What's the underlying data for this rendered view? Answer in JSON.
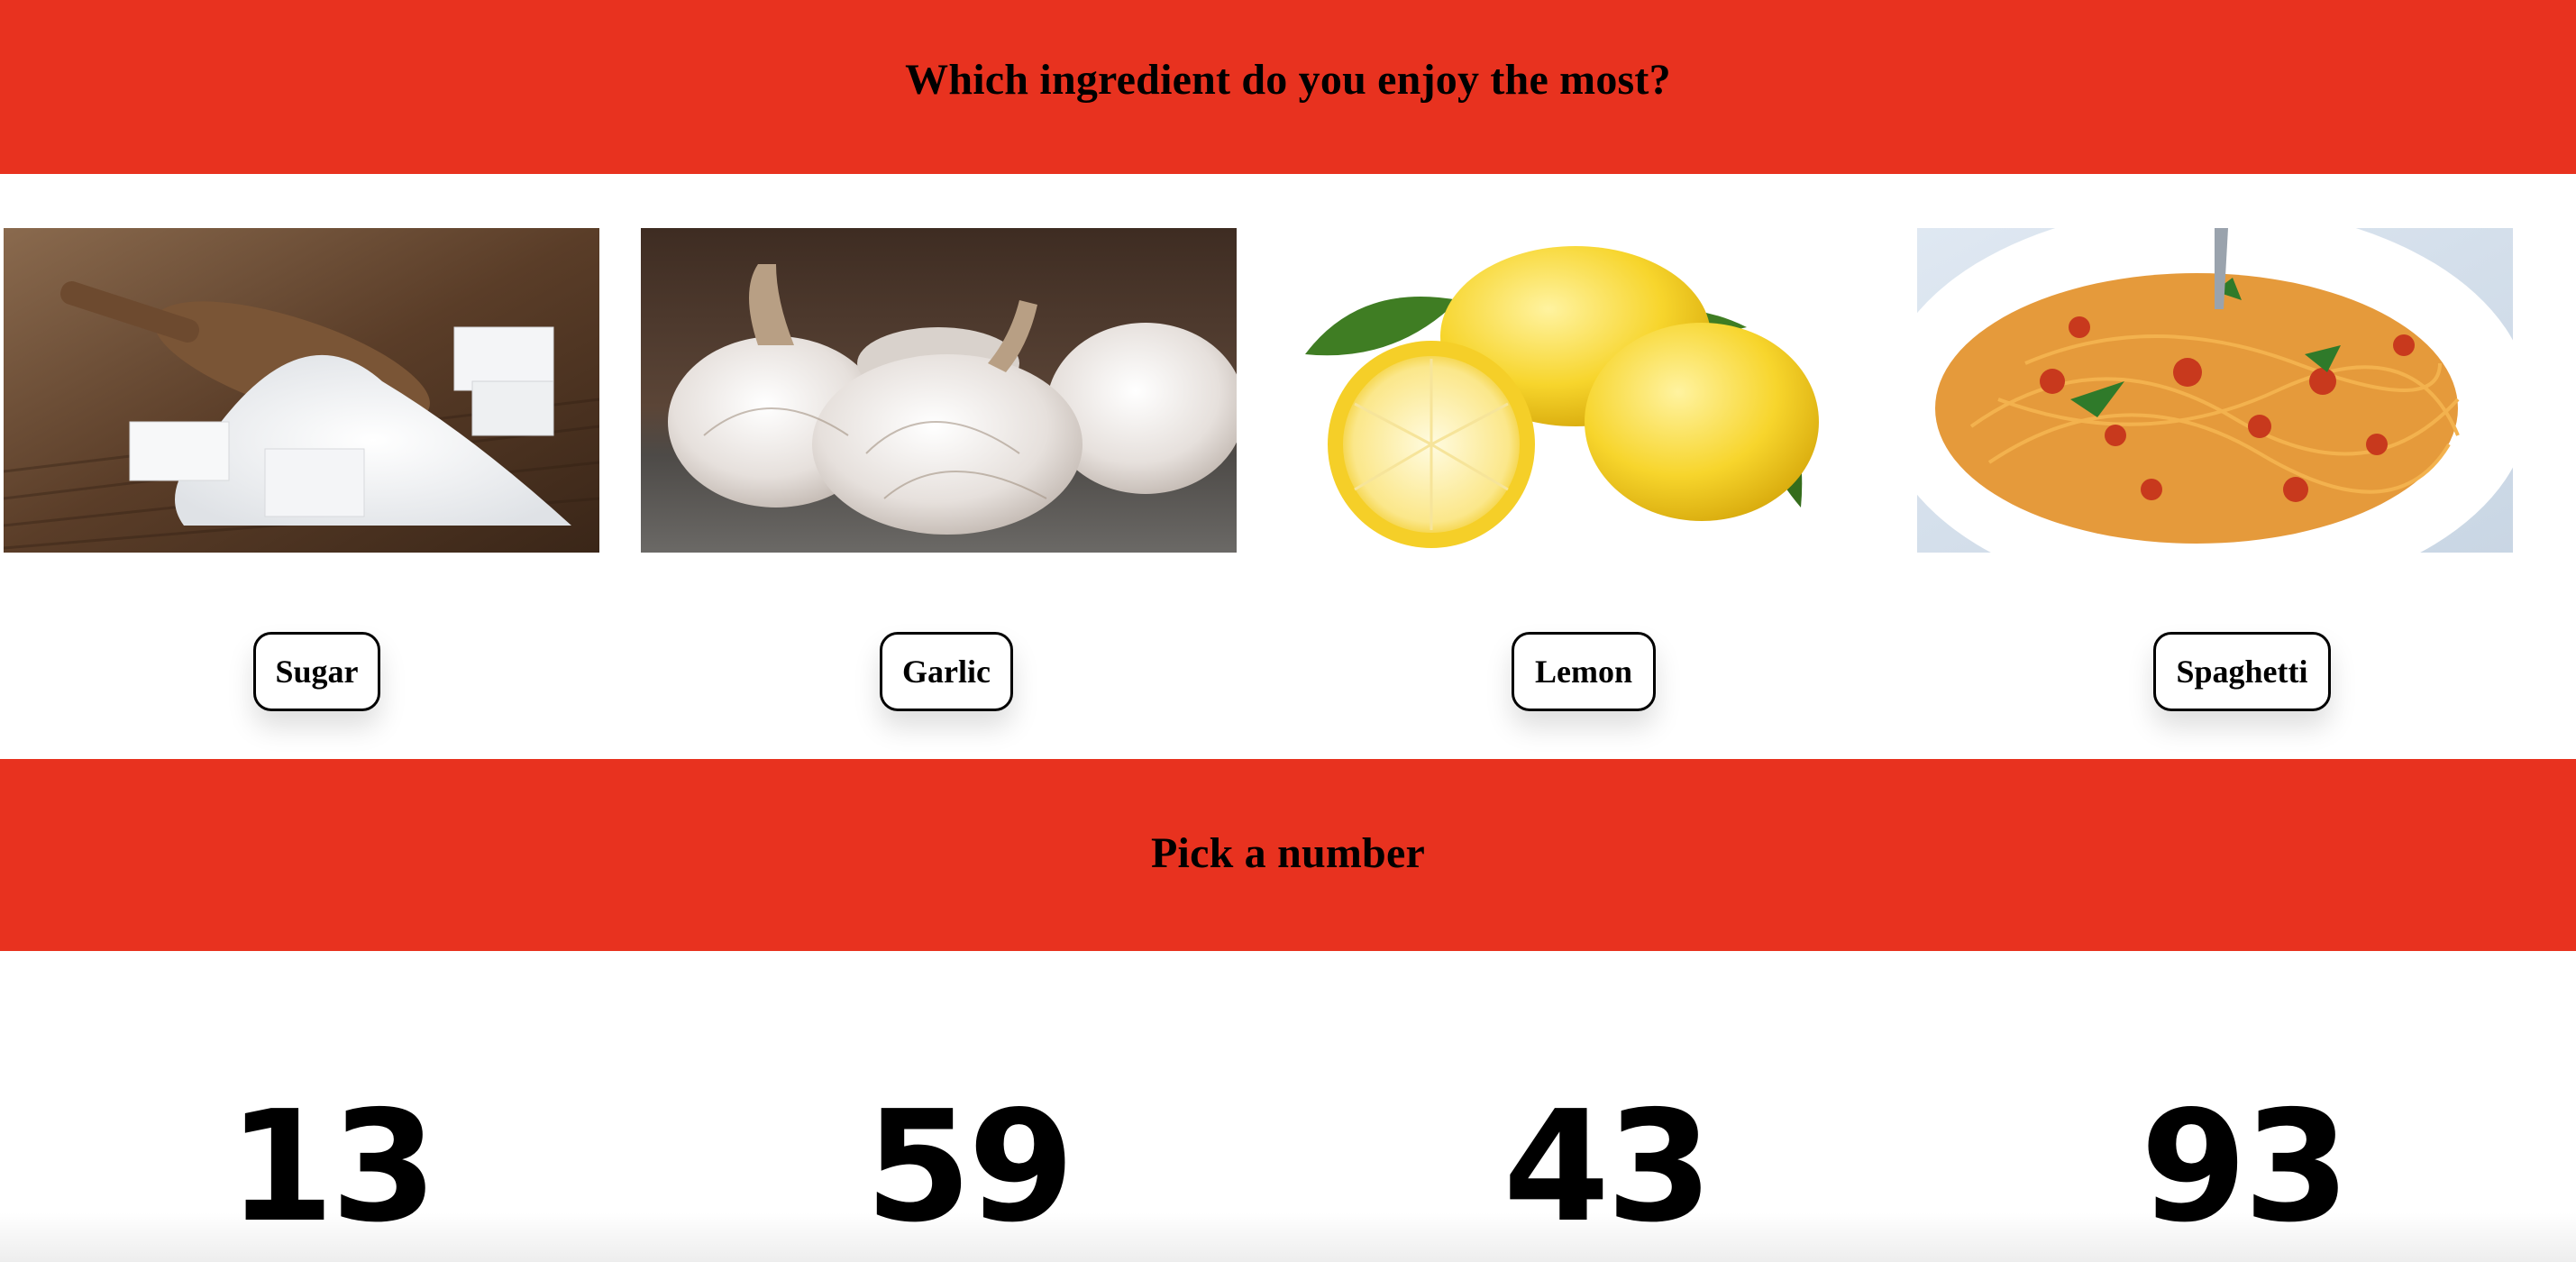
{
  "question1": {
    "title": "Which ingredient do you enjoy the most?",
    "options": [
      {
        "label": "Sugar",
        "image": "sugar-photo"
      },
      {
        "label": "Garlic",
        "image": "garlic-photo"
      },
      {
        "label": "Lemon",
        "image": "lemon-photo"
      },
      {
        "label": "Spaghetti",
        "image": "spaghetti-photo"
      }
    ]
  },
  "question2": {
    "title": "Pick a number",
    "options": [
      "13",
      "59",
      "43",
      "93"
    ]
  },
  "colors": {
    "banner": "#e8321f",
    "text": "#000000",
    "background": "#ffffff"
  }
}
